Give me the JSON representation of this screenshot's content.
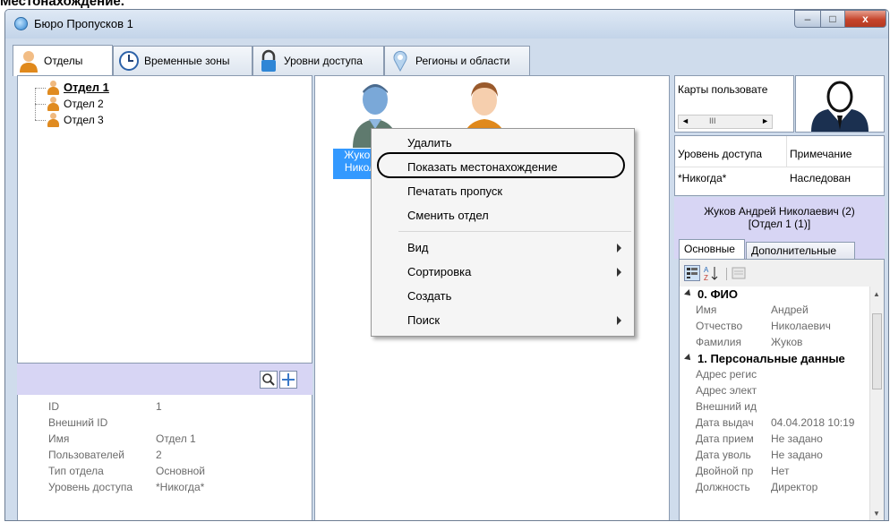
{
  "heading": "Местонахождение.",
  "window": {
    "title": "Бюро Пропусков 1",
    "controls": {
      "minimize": "–",
      "maximize": "□",
      "close": "x"
    }
  },
  "tabs": [
    {
      "label": "Отделы",
      "icon": "person-icon",
      "active": true
    },
    {
      "label": "Временные зоны",
      "icon": "clock-icon",
      "active": false
    },
    {
      "label": "Уровни доступа",
      "icon": "padlock-icon",
      "active": false
    },
    {
      "label": "Регионы и области",
      "icon": "map-pin-icon",
      "active": false
    }
  ],
  "tree": {
    "items": [
      {
        "label": "Отдел 1",
        "selected": true
      },
      {
        "label": "Отдел 2",
        "selected": false
      },
      {
        "label": "Отдел 3",
        "selected": false
      }
    ]
  },
  "left_toolbar": {
    "search_icon": "search-icon",
    "add_icon": "plus-icon"
  },
  "department_properties": [
    {
      "key": "ID",
      "value": "1"
    },
    {
      "key": "Внешний ID",
      "value": ""
    },
    {
      "key": "Имя",
      "value": "Отдел 1"
    },
    {
      "key": "Пользователей",
      "value": "2"
    },
    {
      "key": "Тип отдела",
      "value": "Основной"
    },
    {
      "key": "Уровень доступа",
      "value": "*Никогда*"
    }
  ],
  "employees": [
    {
      "label": "Жуков\nНикол",
      "avatar": "blue-person-icon",
      "selected": true
    },
    {
      "label": "",
      "avatar": "orange-person-icon",
      "selected": false
    }
  ],
  "context_menu": {
    "items": [
      {
        "label": "Удалить",
        "submenu": false
      },
      {
        "label": "Показать местонахождение",
        "submenu": false,
        "highlighted": true
      },
      {
        "label": "Печатать пропуск",
        "submenu": false
      },
      {
        "label": "Сменить отдел",
        "submenu": false
      },
      {
        "label": "Вид",
        "submenu": true
      },
      {
        "label": "Сортировка",
        "submenu": true
      },
      {
        "label": "Создать",
        "submenu": false
      },
      {
        "label": "Поиск",
        "submenu": true
      }
    ]
  },
  "right": {
    "cards_header": "Карты пользовате",
    "scroll_thumb": "III",
    "access_table": {
      "headers": [
        "Уровень доступа",
        "Примечание"
      ],
      "rows": [
        [
          "*Никогда*",
          "Наследован"
        ]
      ]
    },
    "user_title_line1": "Жуков Андрей Николаевич (2)",
    "user_title_line2": "[Отдел 1 (1)]",
    "tabs": [
      {
        "label": "Основные",
        "active": true
      },
      {
        "label": "Дополнительные",
        "active": false
      }
    ],
    "pg_toolbar": {
      "categorized_icon": "categorized-view-icon",
      "sort_icon": "sort-az-icon",
      "pages_icon": "property-pages-icon"
    },
    "property_grid": [
      {
        "type": "category",
        "label": "0. ФИО"
      },
      {
        "type": "row",
        "key": "Имя",
        "value": "Андрей"
      },
      {
        "type": "row",
        "key": "Отчество",
        "value": "Николаевич"
      },
      {
        "type": "row",
        "key": "Фамилия",
        "value": "Жуков"
      },
      {
        "type": "category",
        "label": "1. Персональные данные"
      },
      {
        "type": "row",
        "key": "Адрес регис",
        "value": ""
      },
      {
        "type": "row",
        "key": "Адрес элект",
        "value": ""
      },
      {
        "type": "row",
        "key": "Внешний ид",
        "value": ""
      },
      {
        "type": "row",
        "key": "Дата выдач",
        "value": "04.04.2018 10:19"
      },
      {
        "type": "row",
        "key": "Дата прием",
        "value": "Не задано"
      },
      {
        "type": "row",
        "key": "Дата уволь",
        "value": "Не задано"
      },
      {
        "type": "row",
        "key": "Двойной пр",
        "value": "Нет"
      },
      {
        "type": "row",
        "key": "Должность",
        "value": "Директор"
      }
    ]
  }
}
